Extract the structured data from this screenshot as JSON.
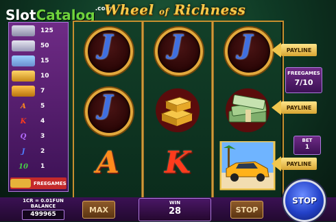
{
  "header": {
    "logo_part1": "Slot",
    "logo_part2": "Catalog",
    "logo_suffix": ".com",
    "title_a": "Wheel",
    "title_of": "of",
    "title_b": "Richness"
  },
  "paytable": {
    "rows": [
      {
        "symbol": "bars-stack",
        "value": "125"
      },
      {
        "symbol": "cash-stack",
        "value": "50"
      },
      {
        "symbol": "car",
        "value": "15"
      },
      {
        "symbol": "gold-coins",
        "value": "10"
      },
      {
        "symbol": "gold-bars",
        "value": "7"
      },
      {
        "symbol": "A",
        "value": "5"
      },
      {
        "symbol": "K",
        "value": "4"
      },
      {
        "symbol": "Q",
        "value": "3"
      },
      {
        "symbol": "J",
        "value": "2"
      },
      {
        "symbol": "10",
        "value": "1"
      }
    ],
    "free_label": "FREEGAMES"
  },
  "reels": {
    "reel1": [
      "J",
      "J",
      "A"
    ],
    "reel2": [
      "J",
      "gold-bars",
      "K"
    ],
    "reel3": [
      "J",
      "cash-stack",
      "car"
    ]
  },
  "right_panel": {
    "payline_label": "PAYLINE",
    "freegames_label": "FREEGAMES",
    "freegames_value": "7/10",
    "bet_label": "BET",
    "bet_value": "1",
    "stop_label": "STOP"
  },
  "bottom": {
    "rate": "1CR = 0.01FUN",
    "balance_label": "BALANCE",
    "balance_value": "499965",
    "max_label": "MAX",
    "win_label": "WIN",
    "win_value": "28",
    "stop_label": "STOP"
  },
  "colors": {
    "accent_gold": "#e2a83c",
    "panel_purple": "#3b1154",
    "stop_blue": "#2341c8"
  }
}
